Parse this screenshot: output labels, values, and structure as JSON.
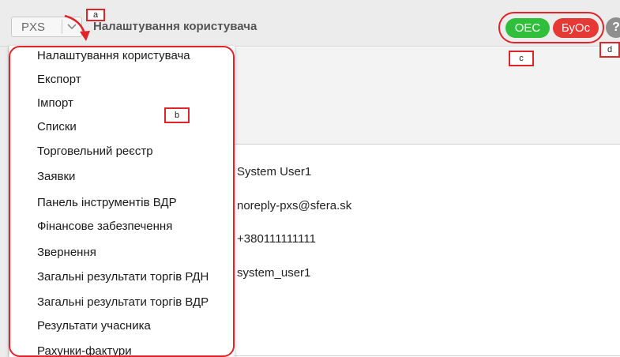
{
  "header": {
    "app_name": "PXS",
    "page_title": "Налаштування користувача",
    "badges": {
      "oes": "ОЕС",
      "buos": "БуОс"
    },
    "help_glyph": "?"
  },
  "profile_values": {
    "name": "System User1",
    "email": "noreply-pxs@sfera.sk",
    "phone": "+380111111111",
    "login": "system_user1"
  },
  "menu": {
    "items": [
      "Налаштування користувача",
      "Експорт",
      "Імпорт",
      "Списки",
      "Торговельний реєстр",
      "Заявки",
      "Панель інструментів ВДР",
      "Фінансове забезпечення",
      "Звернення",
      "Загальні результати торгів РДН",
      "Загальні результати торгів ВДР",
      "Результати учасника",
      "Рахунки-фактури"
    ]
  },
  "annotations": {
    "a": "a",
    "b": "b",
    "c": "c",
    "d": "d"
  },
  "colors": {
    "accent_red": "#e0242a",
    "green": "#2fbf3a",
    "red": "#e53935"
  }
}
